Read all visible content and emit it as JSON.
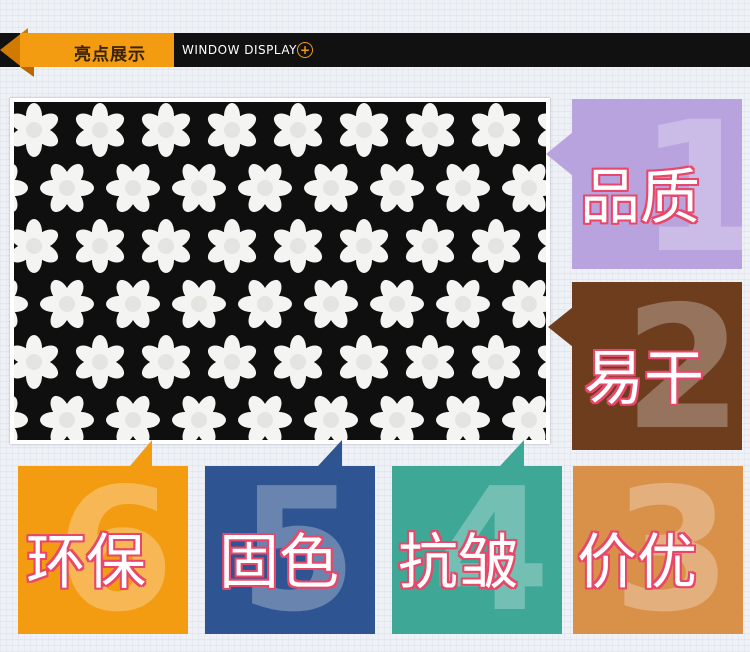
{
  "header": {
    "title": "亮点展示",
    "subtitle": "WINDOW DISPLAY",
    "plus_symbol": "+",
    "accent_color": "#f39c12",
    "bar_color": "#111111"
  },
  "photo": {
    "subject": "lace-fabric-photo",
    "background_color": "#0f0f0f",
    "motif_color": "#f4f4f2"
  },
  "features": [
    {
      "number": "1",
      "label": "品质",
      "color": "#b8a3de"
    },
    {
      "number": "2",
      "label": "易干",
      "color": "#6e3d1e"
    },
    {
      "number": "3",
      "label": "价优",
      "color": "#d9914a"
    },
    {
      "number": "4",
      "label": "抗皱",
      "color": "#3fa796"
    },
    {
      "number": "5",
      "label": "固色",
      "color": "#2e5591"
    },
    {
      "number": "6",
      "label": "环保",
      "color": "#f39c12"
    }
  ]
}
